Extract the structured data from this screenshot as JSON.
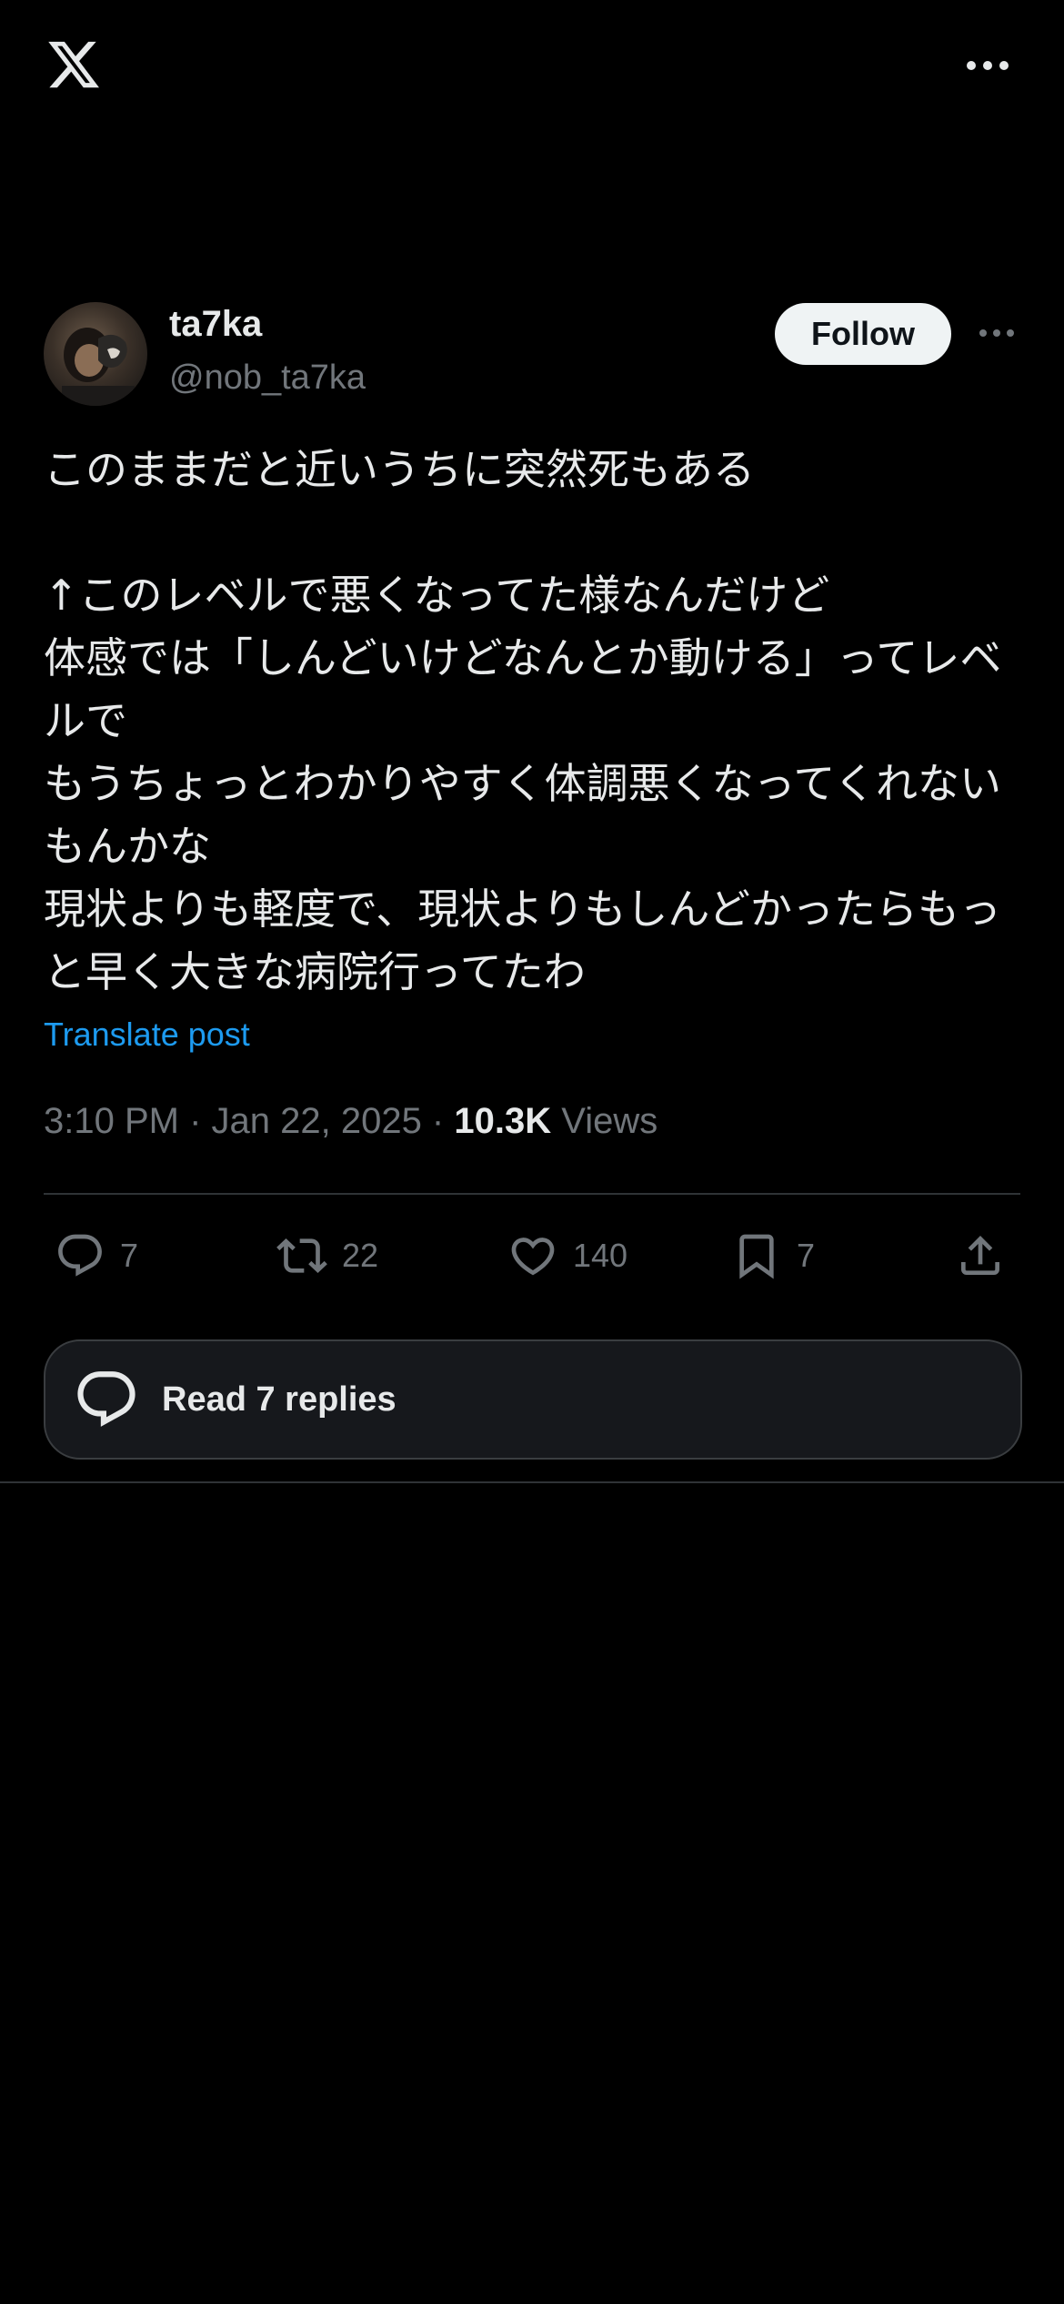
{
  "header": {
    "logo_icon": "x-logo-icon",
    "more_icon": "more-horizontal-icon"
  },
  "post": {
    "author_name": "ta7ka",
    "author_handle": "@nob_ta7ka",
    "follow_label": "Follow",
    "text": "このままだと近いうちに突然死もある\n\n↑このレベルで悪くなってた様なんだけど\n体感では「しんどいけどなんとか動ける」ってレベルで\nもうちょっとわかりやすく体調悪くなってくれないもんかな\n現状よりも軽度で、現状よりもしんどかったらもっと早く大きな病院行ってたわ",
    "translate_label": "Translate post",
    "timestamp": "3:10 PM · Jan 22, 2025 · ",
    "views_count": "10.3K",
    "views_label": " Views"
  },
  "actions": {
    "replies": "7",
    "reposts": "22",
    "likes": "140",
    "bookmarks": "7"
  },
  "read_replies_label": "Read 7 replies",
  "colors": {
    "background": "#000000",
    "primary_text": "#e7e9ea",
    "secondary_text": "#71767b",
    "link": "#1d9bf0",
    "follow_bg": "#eff3f4",
    "divider": "#2f3336"
  }
}
